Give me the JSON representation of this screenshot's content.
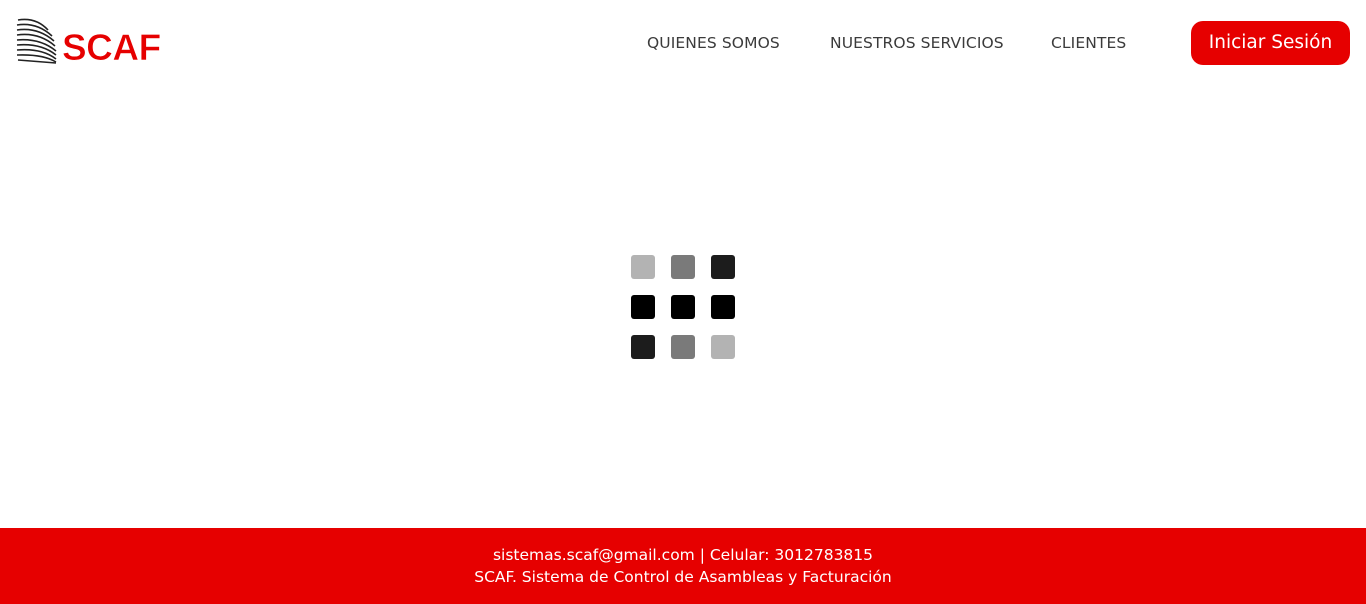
{
  "header": {
    "logo_text": "SCAF",
    "nav": [
      {
        "label": "QUIENES SOMOS"
      },
      {
        "label": "NUESTROS SERVICIOS"
      },
      {
        "label": "CLIENTES"
      }
    ],
    "login_label": "Iniciar Sesión"
  },
  "loader": {
    "cells": [
      {
        "color": "#b3b3b3"
      },
      {
        "color": "#7a7a7a"
      },
      {
        "color": "#1c1c1c"
      },
      {
        "color": "#000000"
      },
      {
        "color": "#000000"
      },
      {
        "color": "#000000"
      },
      {
        "color": "#1c1c1c"
      },
      {
        "color": "#7a7a7a"
      },
      {
        "color": "#b3b3b3"
      }
    ]
  },
  "footer": {
    "email": "sistemas.scaf@gmail.com",
    "separator": " | ",
    "phone": "Celular: 3012783815",
    "tagline": "SCAF. Sistema de Control de Asambleas y Facturación"
  },
  "colors": {
    "brand": "#e60000",
    "nav_text": "#3b3b3b",
    "footer_text": "#ffffff"
  }
}
